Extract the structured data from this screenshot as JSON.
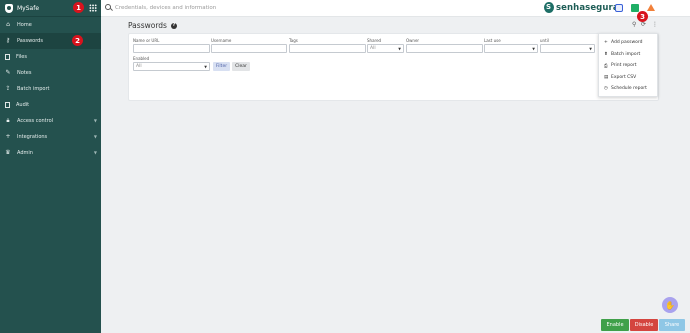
{
  "app": {
    "name": "MySafe"
  },
  "badges": [
    "1",
    "2",
    "3"
  ],
  "sidebar": {
    "items": [
      {
        "label": "Home",
        "icon": "home-icon"
      },
      {
        "label": "Passwords",
        "icon": "key-icon"
      },
      {
        "label": "Files",
        "icon": "file-icon"
      },
      {
        "label": "Notes",
        "icon": "note-icon"
      },
      {
        "label": "Batch import",
        "icon": "import-icon"
      },
      {
        "label": "Audit",
        "icon": "audit-icon"
      },
      {
        "label": "Access control",
        "icon": "lock-icon"
      },
      {
        "label": "Integrations",
        "icon": "plus-icon"
      },
      {
        "label": "Admin",
        "icon": "admin-icon"
      }
    ]
  },
  "search": {
    "placeholder": "Credentials, devices and information"
  },
  "logo": {
    "text": "senhasegura"
  },
  "page": {
    "title": "Passwords",
    "help": "?"
  },
  "filters": {
    "name_label": "Name or URL",
    "username_label": "Username",
    "tags_label": "Tags",
    "shared_label": "Shared",
    "shared_value": "All",
    "owner_label": "Owner",
    "last_use_label": "Last use",
    "until_label": "until",
    "enabled_label": "Enabled",
    "enabled_value": "All",
    "filter_button": "Filter",
    "clear_button": "Clear"
  },
  "menu": {
    "items": [
      {
        "label": "Add password",
        "icon": "+"
      },
      {
        "label": "Batch import",
        "icon": "⬆"
      },
      {
        "label": "Print report",
        "icon": "⎙"
      },
      {
        "label": "Export CSV",
        "icon": "▤"
      },
      {
        "label": "Schedule report",
        "icon": "◷"
      }
    ]
  },
  "footer": {
    "enable": "Enable",
    "disable": "Disable",
    "share": "Share"
  }
}
